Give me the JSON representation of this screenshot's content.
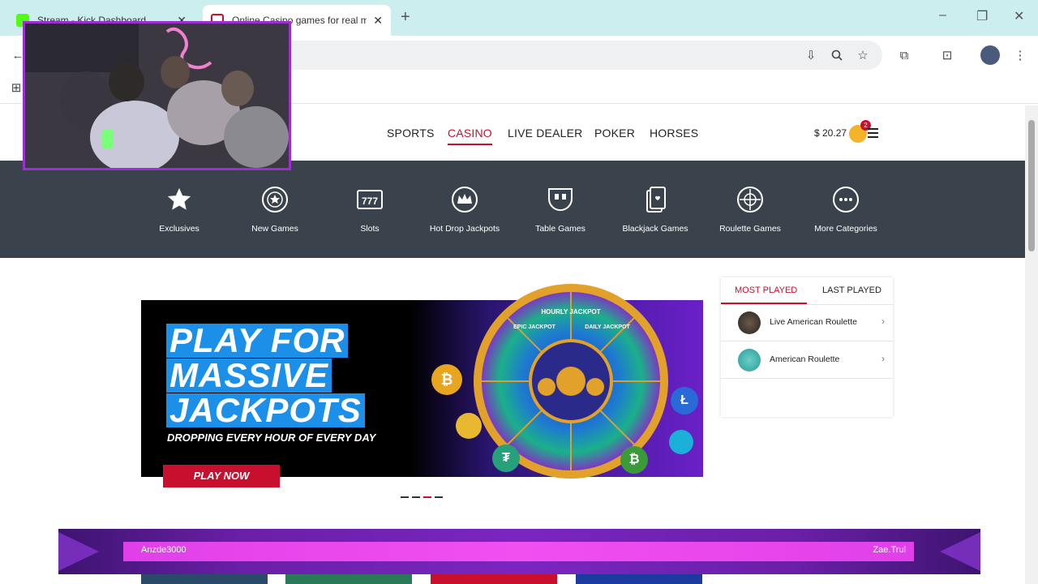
{
  "browser": {
    "tabs": [
      {
        "title": "Stream - Kick Dashboard"
      },
      {
        "title": "Online Casino games for real m"
      }
    ]
  },
  "site": {
    "nav": [
      "SPORTS",
      "CASINO",
      "LIVE DEALER",
      "POKER",
      "HORSES"
    ],
    "active_nav": "CASINO",
    "balance": "$ 20.27",
    "notification_count": "2",
    "categories": [
      {
        "label": "Exclusives",
        "icon": "star-icon"
      },
      {
        "label": "New Games",
        "icon": "new-games-icon"
      },
      {
        "label": "Slots",
        "icon": "slots-icon"
      },
      {
        "label": "Hot Drop Jackpots",
        "icon": "crown-icon"
      },
      {
        "label": "Table Games",
        "icon": "table-games-icon"
      },
      {
        "label": "Blackjack Games",
        "icon": "cards-icon"
      },
      {
        "label": "Roulette Games",
        "icon": "roulette-icon"
      },
      {
        "label": "More Categories",
        "icon": "more-icon"
      }
    ]
  },
  "banner": {
    "headline": [
      "PLAY FOR",
      "MASSIVE",
      "JACKPOTS"
    ],
    "subline": "DROPPING EVERY HOUR OF EVERY DAY",
    "cta": "PLAY NOW",
    "wheel_labels": [
      "HOURLY JACKPOT",
      "DAILY JACKPOT",
      "EPIC JACKPOT"
    ]
  },
  "played": {
    "tabs": [
      "MOST PLAYED",
      "LAST PLAYED"
    ],
    "items": [
      {
        "name": "Live American Roulette"
      },
      {
        "name": "American Roulette"
      }
    ]
  },
  "stream": {
    "left_user": "Anzde3000",
    "right_user": "Zae.Trul"
  },
  "colors": {
    "accent": "#c8102e",
    "category_bar": "#3a434b",
    "tab_strip": "#cdeeee"
  }
}
